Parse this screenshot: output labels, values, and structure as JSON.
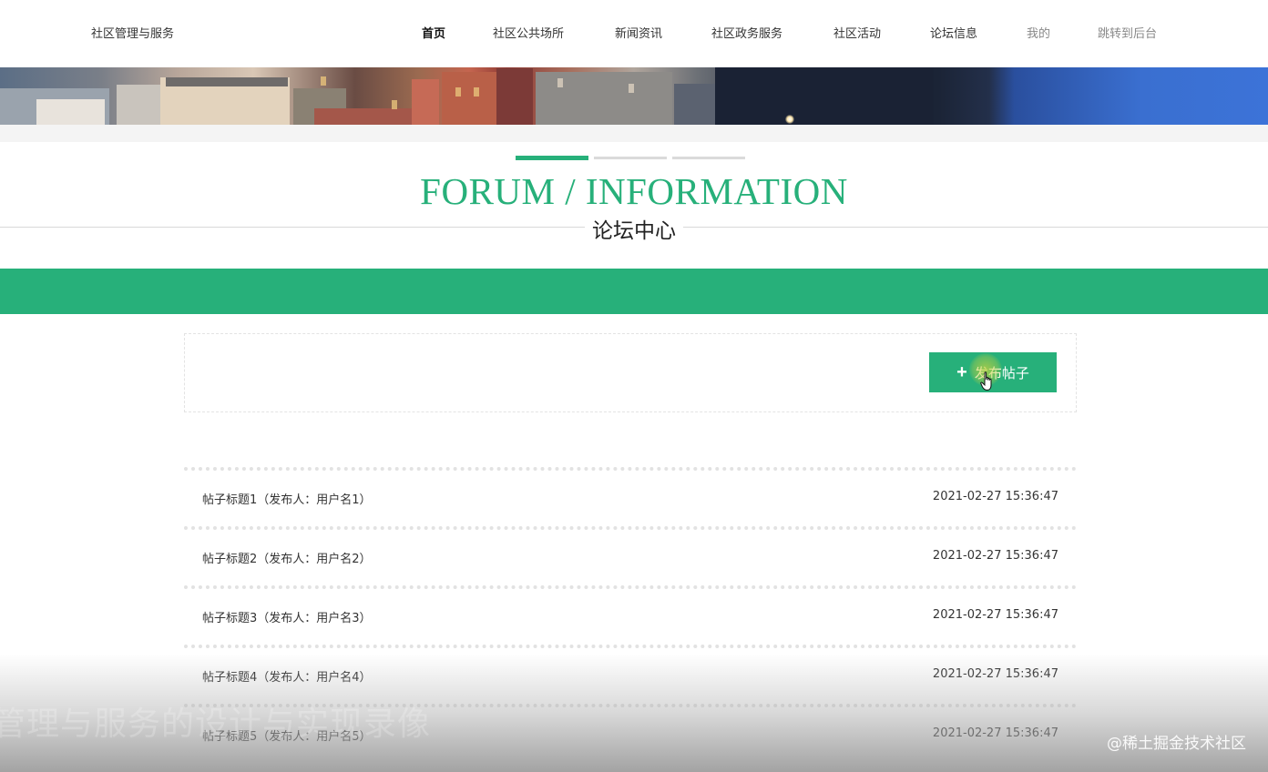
{
  "header": {
    "site_title": "社区管理与服务",
    "nav": [
      {
        "label": "首页"
      },
      {
        "label": "社区公共场所"
      },
      {
        "label": "新闻资讯"
      },
      {
        "label": "社区政务服务"
      },
      {
        "label": "社区活动"
      },
      {
        "label": "论坛信息"
      },
      {
        "label": "我的"
      },
      {
        "label": "跳转到后台"
      }
    ]
  },
  "section": {
    "title_en": "FORUM / INFORMATION",
    "title_cn": "论坛中心"
  },
  "actions": {
    "post_button_label": "发布帖子",
    "post_button_icon": "plus-icon"
  },
  "posts": [
    {
      "title": "帖子标题1（发布人：用户名1）",
      "time": "2021-02-27 15:36:47"
    },
    {
      "title": "帖子标题2（发布人：用户名2）",
      "time": "2021-02-27 15:36:47"
    },
    {
      "title": "帖子标题3（发布人：用户名3）",
      "time": "2021-02-27 15:36:47"
    },
    {
      "title": "帖子标题4（发布人：用户名4）",
      "time": "2021-02-27 15:36:47"
    },
    {
      "title": "帖子标题5（发布人：用户名5）",
      "time": "2021-02-27 15:36:47"
    }
  ],
  "overlay": {
    "ghost_caption": "管理与服务的设计与实现录像",
    "watermark": "@稀土掘金技术社区"
  },
  "colors": {
    "accent": "#27b07a",
    "text": "#333333",
    "divider": "#d8d8d8"
  }
}
